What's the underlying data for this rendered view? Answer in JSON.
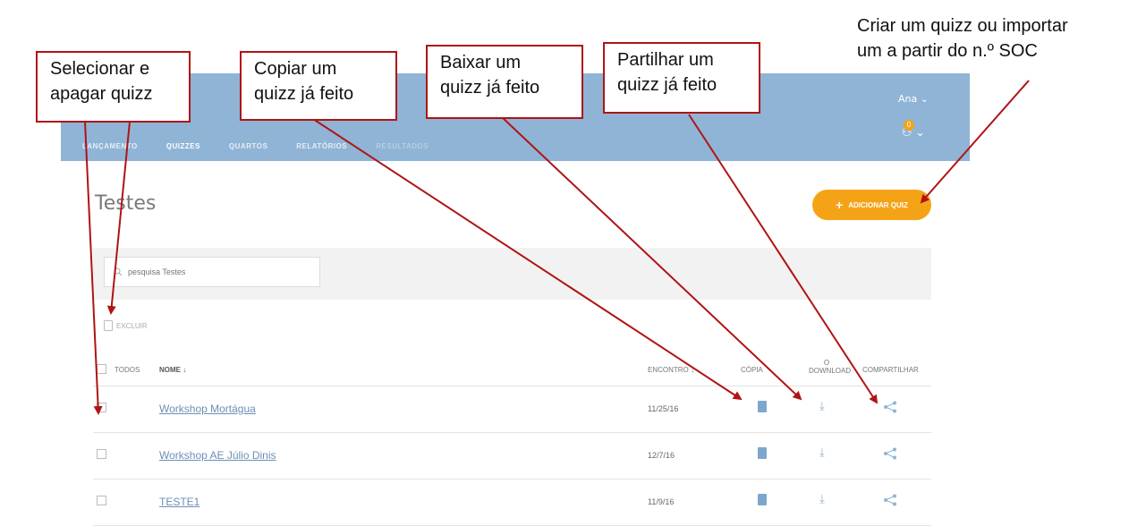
{
  "header": {
    "user_name": "Ana",
    "notification_count": "0",
    "tabs": [
      {
        "label": "LANÇAMENTO"
      },
      {
        "label": "QUIZZES"
      },
      {
        "label": "QUARTOS"
      },
      {
        "label": "RELATÓRIOS"
      },
      {
        "label": "RESULTADOS"
      }
    ],
    "active_tab": "QUIZZES"
  },
  "page": {
    "title": "Testes",
    "add_button_label": "ADICIONAR QUIZ",
    "search_placeholder": "pesquisa Testes",
    "delete_label": "EXCLUIR"
  },
  "table": {
    "headers": {
      "all": "TODOS",
      "name": "NOME ↓",
      "date": "ENCONTRO ↓",
      "copy": "CÓPIA",
      "download_top": "O",
      "download_bottom": "DOWNLOAD",
      "share": "COMPARTILHAR"
    },
    "rows": [
      {
        "name": "Workshop Mortágua",
        "date": "11/25/16"
      },
      {
        "name": "Workshop AE Júlio Dinis",
        "date": "12/7/16"
      },
      {
        "name": "TESTE1",
        "date": "11/9/16"
      }
    ]
  },
  "callouts": {
    "select_delete": [
      "Selecionar e",
      "apagar quizz"
    ],
    "copy": [
      "Copiar um",
      "quizz já feito"
    ],
    "download": [
      "Baixar um",
      "quizz já feito"
    ],
    "share": [
      "Partilhar um",
      "quizz já feito"
    ],
    "create": [
      "Criar um quizz ou importar",
      "um a partir do n.º SOC"
    ]
  },
  "colors": {
    "header_blue": "#8fb4d6",
    "accent_orange": "#f5a316",
    "arrow_red": "#b01414",
    "link_blue": "#6b8fb5"
  }
}
